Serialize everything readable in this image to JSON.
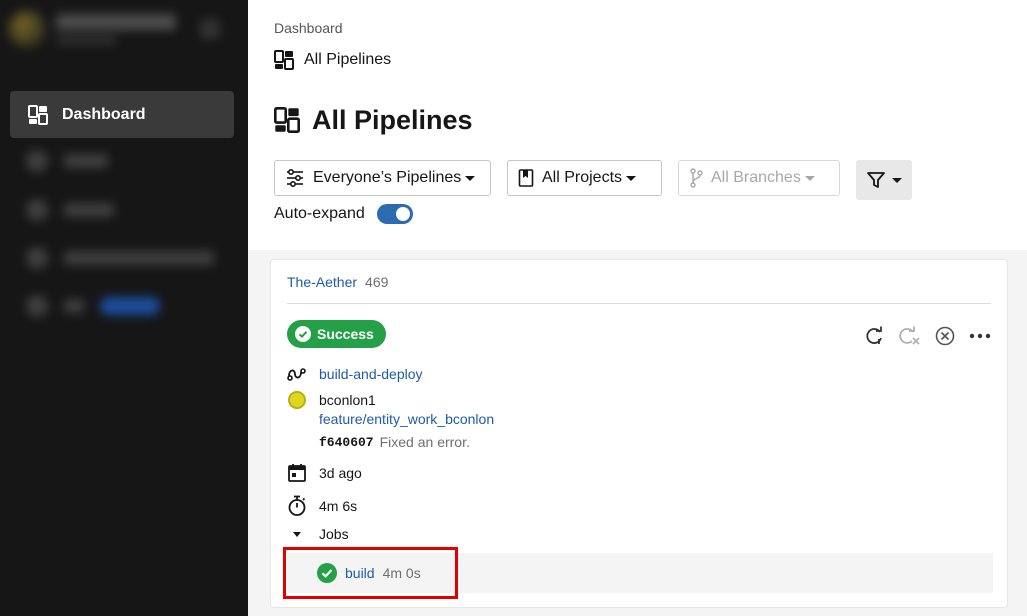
{
  "sidebar": {
    "items": [
      {
        "label": "Dashboard",
        "icon": "dashboard-icon"
      }
    ]
  },
  "breadcrumb": "Dashboard",
  "crumb_page": "All Pipelines",
  "page_title": "All Pipelines",
  "filters": {
    "pipelines": "Everyone’s Pipelines",
    "projects": "All Projects",
    "branches": "All Branches"
  },
  "auto_expand": {
    "label": "Auto-expand",
    "enabled": true
  },
  "card": {
    "project": "The-Aether",
    "number": "469",
    "status": "Success",
    "workflow": "build-and-deploy",
    "user": "bconlon1",
    "branch": "feature/entity_work_bconlon",
    "commit_sha": "f640607",
    "commit_message": "Fixed an error.",
    "time_ago": "3d ago",
    "duration": "4m 6s",
    "jobs_label": "Jobs",
    "jobs": [
      {
        "name": "build",
        "duration": "4m 0s"
      }
    ]
  },
  "colors": {
    "success": "#24a148",
    "link": "#1e5ba8",
    "sidebar": "#161616",
    "highlight": "#e00000"
  }
}
